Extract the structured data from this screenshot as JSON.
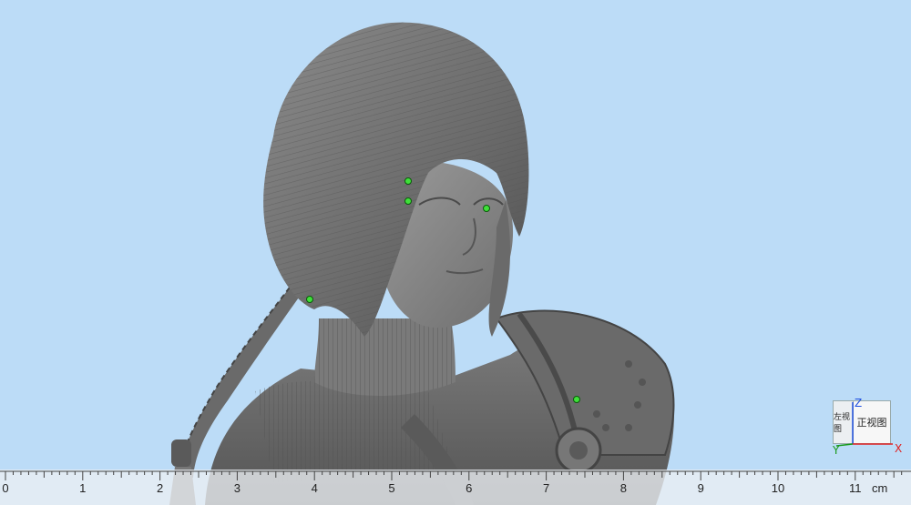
{
  "view_cube": {
    "left_face_label": "左视图",
    "front_face_label": "正视图",
    "axis_z": "Z",
    "axis_y": "Y",
    "axis_x": "X"
  },
  "ruler": {
    "unit": "cm",
    "labels": [
      "0",
      "1",
      "2",
      "3",
      "4",
      "5",
      "6",
      "7",
      "8",
      "9",
      "10",
      "11"
    ]
  },
  "colors": {
    "background": "#bcdcf7",
    "model": "#6e6e6e",
    "marker": "#3fe03a"
  }
}
